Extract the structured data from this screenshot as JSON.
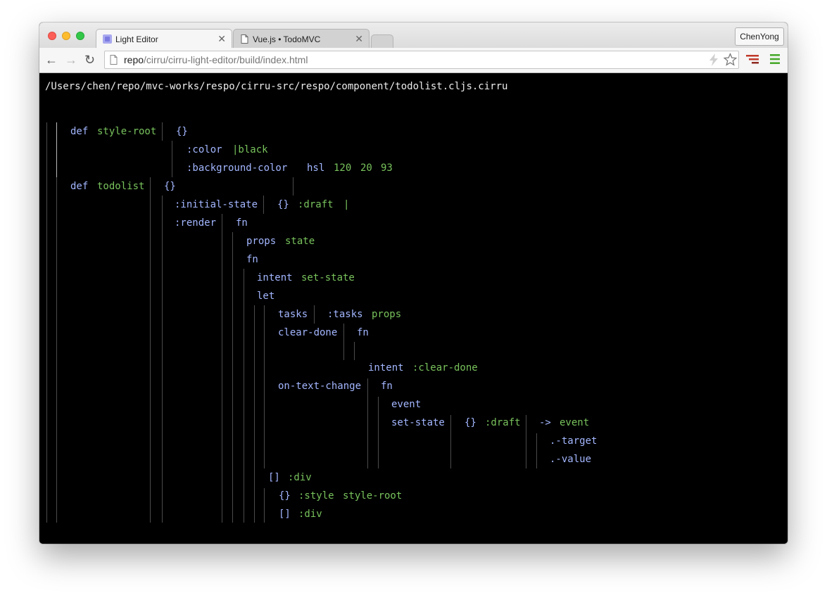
{
  "window": {
    "tabs": [
      {
        "label": "Light Editor",
        "icon": "cirru-favicon"
      },
      {
        "label": "Vue.js • TodoMVC",
        "icon": "page-icon"
      }
    ],
    "profile_name": "ChenYong"
  },
  "toolbar": {
    "url_host": "repo",
    "url_path": "/cirru/cirru-light-editor/build/index.html"
  },
  "editor": {
    "file_path": "/Users/chen/repo/mvc-works/respo/cirru-src/respo/component/todolist.cljs.cirru",
    "tokens": [
      "def",
      "style-root",
      "{}",
      ":color",
      "|black",
      ":background-color",
      "hsl",
      "120",
      "20",
      "93",
      "def",
      "todolist",
      "{}",
      ":initial-state",
      "{}",
      ":draft",
      "|",
      ":render",
      "fn",
      "props",
      "state",
      "fn",
      "intent",
      "set-state",
      "let",
      "tasks",
      ":tasks",
      "props",
      "clear-done",
      "fn",
      "intent",
      ":clear-done",
      "on-text-change",
      "fn",
      "event",
      "set-state",
      "{}",
      ":draft",
      "->",
      "event",
      ".-target",
      ".-value",
      "[]",
      ":div",
      "{}",
      ":style",
      "style-root",
      "[]",
      ":div"
    ]
  },
  "colors": {
    "keyword": "#a3b6ff",
    "literal": "#78c25c",
    "editor_bg": "#000000",
    "guide_line": "#4b4b4b"
  }
}
